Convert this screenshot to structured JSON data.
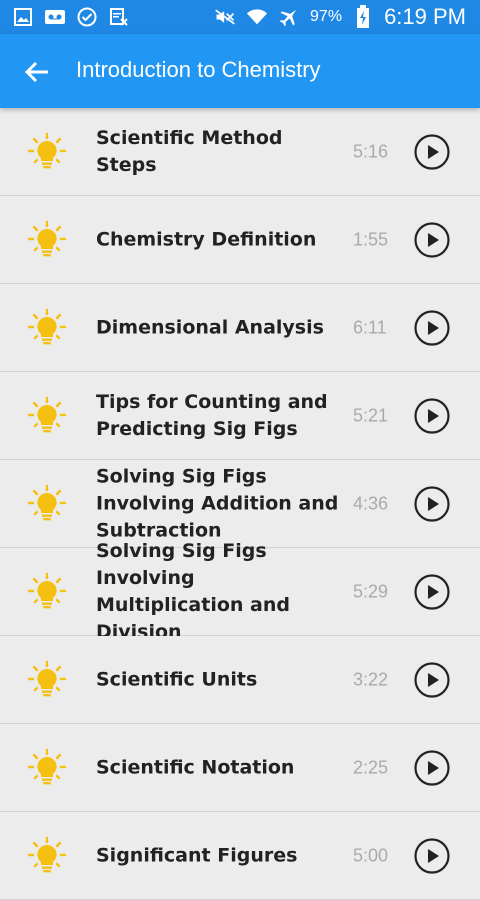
{
  "status_bar": {
    "battery": "97%",
    "time": "6:19 PM",
    "left_icons": [
      "photo-icon",
      "voicemail-icon",
      "check-circle-icon",
      "calendar-icon"
    ],
    "right_icons": [
      "mute-icon",
      "wifi-icon",
      "airplane-icon",
      "battery-charging-icon"
    ]
  },
  "app_bar": {
    "title": "Introduction to Chemistry",
    "back_icon": "arrow-back-icon"
  },
  "lessons": [
    {
      "title": "Scientific Method Steps",
      "duration": "5:16"
    },
    {
      "title": "Chemistry Definition",
      "duration": "1:55"
    },
    {
      "title": "Dimensional Analysis",
      "duration": "6:11"
    },
    {
      "title": "Tips for Counting and Predicting Sig Figs",
      "duration": "5:21"
    },
    {
      "title": "Solving Sig Figs Involving Addition and Subtraction",
      "duration": "4:36"
    },
    {
      "title": "Solving Sig Figs Involving Multiplication and Division",
      "duration": "5:29"
    },
    {
      "title": "Scientific Units",
      "duration": "3:22"
    },
    {
      "title": "Scientific Notation",
      "duration": "2:25"
    },
    {
      "title": "Significant Figures",
      "duration": "5:00"
    }
  ],
  "colors": {
    "status_bar": "#1f88e5",
    "app_bar": "#2196f3",
    "bulb": "#f6c012",
    "background": "#ececec"
  }
}
